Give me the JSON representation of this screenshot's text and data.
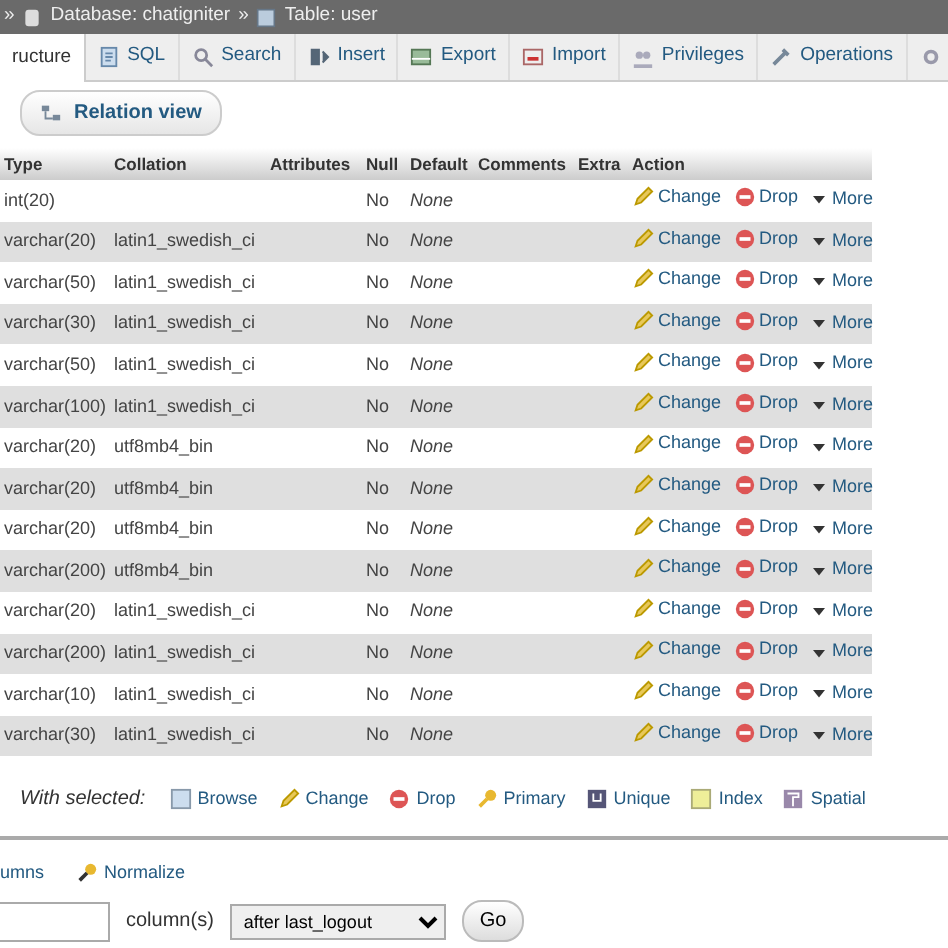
{
  "breadcrumb": [
    {
      "separator": "»",
      "kind": "database",
      "label": "Database: chatigniter"
    },
    {
      "separator": "»",
      "kind": "table",
      "label": "Table: user"
    }
  ],
  "tabs": [
    {
      "label": "ructure",
      "selected": true
    },
    {
      "kind": "sql",
      "label": "SQL",
      "selected": false
    },
    {
      "kind": "search",
      "label": "Search",
      "selected": false
    },
    {
      "kind": "insert",
      "label": "Insert",
      "selected": false
    },
    {
      "kind": "export",
      "label": "Export",
      "selected": false
    },
    {
      "kind": "import",
      "label": "Import",
      "selected": false
    },
    {
      "kind": "privileges",
      "label": "Privileges",
      "selected": false
    },
    {
      "kind": "operations",
      "label": "Operations",
      "selected": false
    },
    {
      "kind": "more",
      "selected": false
    }
  ],
  "toolbar": {
    "label": "Relation view"
  },
  "table": {
    "columns": [
      "Type",
      "Collation",
      "Attributes",
      "Null",
      "Default",
      "Comments",
      "Extra",
      "Action"
    ],
    "rows": [
      {
        "type": "int(20)",
        "collation": "",
        "null": "No",
        "default": "None",
        "actions": [
          "Change",
          "Drop",
          "More"
        ]
      },
      {
        "type": "varchar(20)",
        "collation": "latin1_swedish_ci",
        "null": "No",
        "default": "None",
        "actions": [
          "Change",
          "Drop",
          "More"
        ]
      },
      {
        "type": "varchar(50)",
        "collation": "latin1_swedish_ci",
        "null": "No",
        "default": "None",
        "actions": [
          "Change",
          "Drop",
          "More"
        ]
      },
      {
        "type": "varchar(30)",
        "collation": "latin1_swedish_ci",
        "null": "No",
        "default": "None",
        "actions": [
          "Change",
          "Drop",
          "More"
        ]
      },
      {
        "type": "varchar(50)",
        "collation": "latin1_swedish_ci",
        "null": "No",
        "default": "None",
        "actions": [
          "Change",
          "Drop",
          "More"
        ]
      },
      {
        "type": "varchar(100)",
        "collation": "latin1_swedish_ci",
        "null": "No",
        "default": "None",
        "actions": [
          "Change",
          "Drop",
          "More"
        ]
      },
      {
        "type": "varchar(20)",
        "collation": "utf8mb4_bin",
        "null": "No",
        "default": "None",
        "actions": [
          "Change",
          "Drop",
          "More"
        ]
      },
      {
        "type": "varchar(20)",
        "collation": "utf8mb4_bin",
        "null": "No",
        "default": "None",
        "actions": [
          "Change",
          "Drop",
          "More"
        ]
      },
      {
        "type": "varchar(20)",
        "collation": "utf8mb4_bin",
        "null": "No",
        "default": "None",
        "actions": [
          "Change",
          "Drop",
          "More"
        ]
      },
      {
        "type": "varchar(200)",
        "collation": "utf8mb4_bin",
        "null": "No",
        "default": "None",
        "actions": [
          "Change",
          "Drop",
          "More"
        ]
      },
      {
        "type": "varchar(20)",
        "collation": "latin1_swedish_ci",
        "null": "No",
        "default": "None",
        "actions": [
          "Change",
          "Drop",
          "More"
        ]
      },
      {
        "type": "varchar(200)",
        "collation": "latin1_swedish_ci",
        "null": "No",
        "default": "None",
        "actions": [
          "Change",
          "Drop",
          "More"
        ]
      },
      {
        "type": "varchar(10)",
        "collation": "latin1_swedish_ci",
        "null": "No",
        "default": "None",
        "actions": [
          "Change",
          "Drop",
          "More"
        ]
      },
      {
        "type": "varchar(30)",
        "collation": "latin1_swedish_ci",
        "null": "No",
        "default": "None",
        "actions": [
          "Change",
          "Drop",
          "More"
        ]
      }
    ]
  },
  "with_selected": {
    "label": "With selected:",
    "actions": [
      {
        "kind": "browse",
        "label": "Browse"
      },
      {
        "kind": "change",
        "label": "Change"
      },
      {
        "kind": "drop",
        "label": "Drop"
      },
      {
        "kind": "primary",
        "label": "Primary"
      },
      {
        "kind": "unique",
        "label": "Unique"
      },
      {
        "kind": "index",
        "label": "Index"
      },
      {
        "kind": "spatial",
        "label": "Spatial"
      }
    ]
  },
  "links": [
    {
      "kind": "plain",
      "label": "umns"
    },
    {
      "kind": "normalize",
      "label": "Normalize"
    }
  ],
  "add_columns": {
    "unit": "column(s)",
    "position": "after last_logout",
    "button": "Go"
  }
}
